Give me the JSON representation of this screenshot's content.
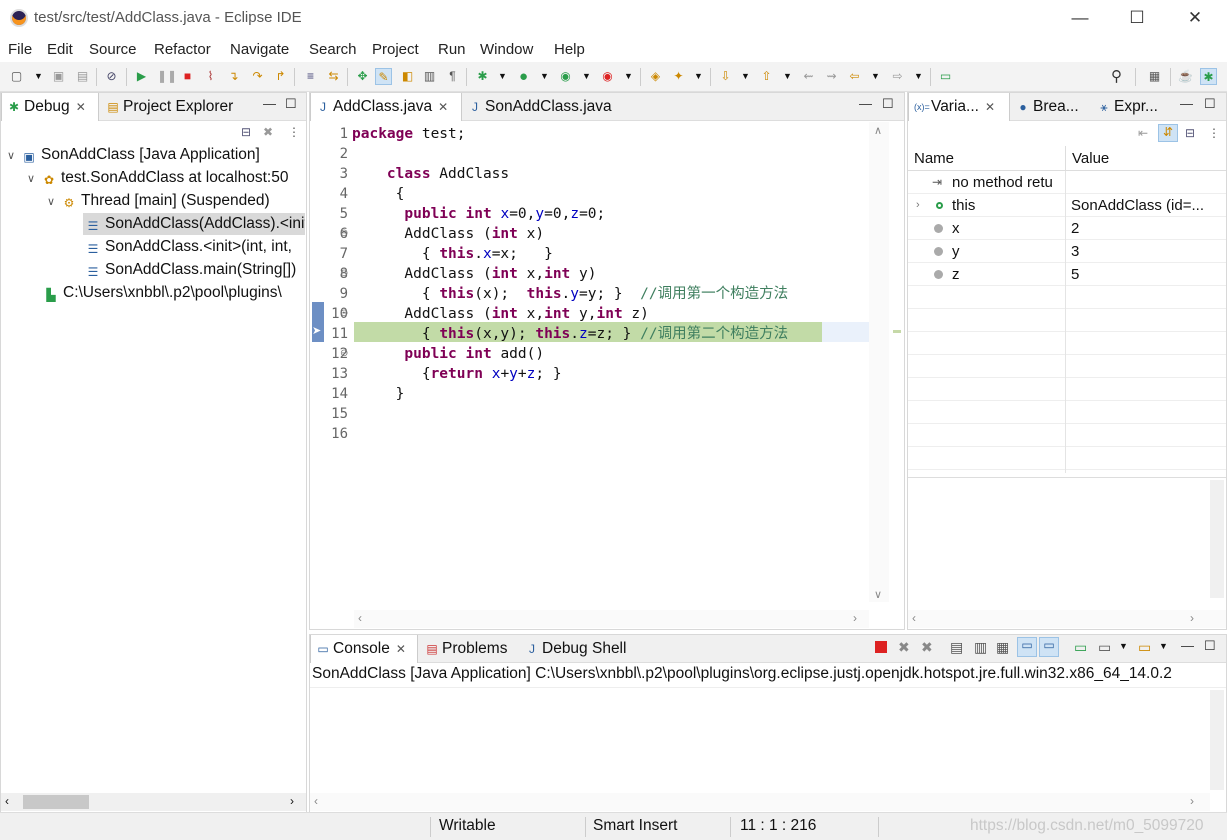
{
  "window": {
    "title": "test/src/test/AddClass.java - Eclipse IDE",
    "minimize": "—",
    "maximize": "☐",
    "close": "✕"
  },
  "menu": [
    "File",
    "Edit",
    "Source",
    "Refactor",
    "Navigate",
    "Search",
    "Project",
    "Run",
    "Window",
    "Help"
  ],
  "debug_panel": {
    "tabs": [
      {
        "label": "Debug",
        "active": true
      },
      {
        "label": "Project Explorer",
        "active": false
      }
    ],
    "tree": [
      {
        "label": "SonAddClass [Java Application]",
        "indent": 0,
        "icon": "java-app-icon"
      },
      {
        "label": "test.SonAddClass at localhost:50",
        "indent": 1,
        "icon": "debug-target-icon"
      },
      {
        "label": "Thread [main] (Suspended)",
        "indent": 2,
        "icon": "thread-icon"
      },
      {
        "label": "SonAddClass(AddClass).<init>",
        "indent": 3,
        "icon": "stack-frame-icon",
        "selected": true
      },
      {
        "label": "SonAddClass.<init>(int, int,",
        "indent": 3,
        "icon": "stack-frame-icon"
      },
      {
        "label": "SonAddClass.main(String[])",
        "indent": 3,
        "icon": "stack-frame-icon"
      },
      {
        "label": "C:\\Users\\xnbbl\\.p2\\pool\\plugins\\",
        "indent": 1,
        "icon": "process-icon"
      }
    ]
  },
  "editor": {
    "tabs": [
      {
        "label": "AddClass.java",
        "active": true
      },
      {
        "label": "SonAddClass.java",
        "active": false
      }
    ],
    "current_line": 11,
    "lines": [
      {
        "n": "1",
        "fold": "",
        "html": "<span class=\"kw\">package</span> test;"
      },
      {
        "n": "2",
        "fold": "",
        "html": ""
      },
      {
        "n": "3",
        "fold": "",
        "html": "    <span class=\"kw\">class</span> AddClass"
      },
      {
        "n": "4",
        "fold": "",
        "html": "     {"
      },
      {
        "n": "5",
        "fold": "",
        "html": "      <span class=\"kw\">public</span> <span class=\"kw\">int</span> <span class=\"fld\">x</span>=0,<span class=\"fld\">y</span>=0,<span class=\"fld\">z</span>=0;"
      },
      {
        "n": "6",
        "fold": "⊖",
        "html": "      AddClass (<span class=\"kw\">int</span> x)"
      },
      {
        "n": "7",
        "fold": "",
        "html": "        { <span class=\"kw\">this</span>.<span class=\"fld\">x</span>=x;   }"
      },
      {
        "n": "8",
        "fold": "⊖",
        "html": "      AddClass (<span class=\"kw\">int</span> x,<span class=\"kw\">int</span> y)"
      },
      {
        "n": "9",
        "fold": "",
        "html": "        { <span class=\"kw\">this</span>(x);  <span class=\"kw\">this</span>.<span class=\"fld\">y</span>=y; }  <span class=\"cmt\">//调用第一个构造方法</span>"
      },
      {
        "n": "10",
        "fold": "⊖",
        "html": "      AddClass (<span class=\"kw\">int</span> x,<span class=\"kw\">int</span> y,<span class=\"kw\">int</span> z)"
      },
      {
        "n": "11",
        "fold": "",
        "html": "        { <span class=\"kw\">this</span>(x,y); <span class=\"kw\">this</span>.<span class=\"fld\">z</span>=z; } <span class=\"cmt\">//调用第二个构造方法</span>"
      },
      {
        "n": "12",
        "fold": "⊖",
        "html": "      <span class=\"kw\">public</span> <span class=\"kw\">int</span> add()"
      },
      {
        "n": "13",
        "fold": "",
        "html": "        {<span class=\"kw\">return</span> <span class=\"fld\">x</span>+<span class=\"fld\">y</span>+<span class=\"fld\">z</span>; }"
      },
      {
        "n": "14",
        "fold": "",
        "html": "     }"
      },
      {
        "n": "15",
        "fold": "",
        "html": ""
      },
      {
        "n": "16",
        "fold": "",
        "html": ""
      }
    ]
  },
  "variables": {
    "tabs": [
      {
        "label": "Varia...",
        "active": true
      },
      {
        "label": "Brea...",
        "active": false
      },
      {
        "label": "Expr...",
        "active": false
      }
    ],
    "columns": {
      "name": "Name",
      "value": "Value"
    },
    "rows": [
      {
        "name": "no method retu",
        "value": "",
        "icon": "return-icon",
        "color": "#555"
      },
      {
        "name": "this",
        "value": "SonAddClass  (id=...",
        "icon": "object-icon",
        "color": "#2a9d4a",
        "expandable": true
      },
      {
        "name": "x",
        "value": "2",
        "icon": "field-icon",
        "color": "#999"
      },
      {
        "name": "y",
        "value": "3",
        "icon": "field-icon",
        "color": "#999"
      },
      {
        "name": "z",
        "value": "5",
        "icon": "field-icon",
        "color": "#999"
      }
    ]
  },
  "console": {
    "tabs": [
      {
        "label": "Console",
        "active": true
      },
      {
        "label": "Problems",
        "active": false
      },
      {
        "label": "Debug Shell",
        "active": false
      }
    ],
    "header": "SonAddClass [Java Application] C:\\Users\\xnbbl\\.p2\\pool\\plugins\\org.eclipse.justj.openjdk.hotspot.jre.full.win32.x86_64_14.0.2"
  },
  "status": {
    "writable": "Writable",
    "insert_mode": "Smart Insert",
    "position": "11 : 1 : 216",
    "watermark": "https://blog.csdn.net/m0_5099720"
  }
}
